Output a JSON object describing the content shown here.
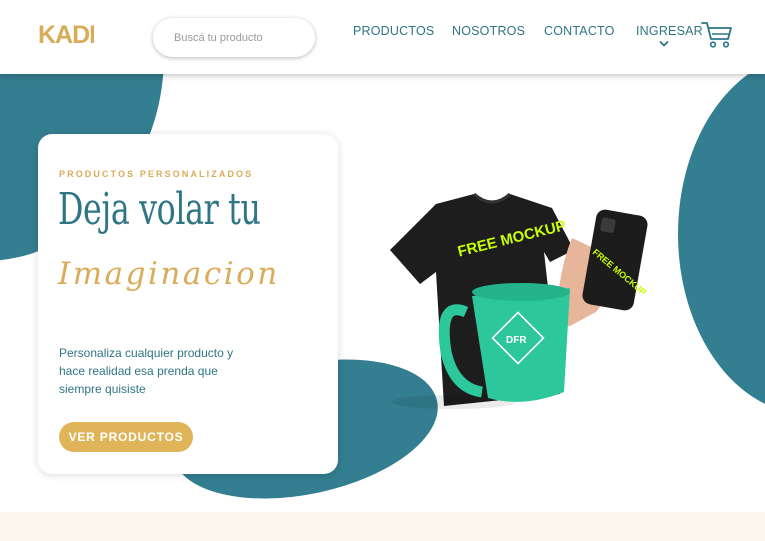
{
  "header": {
    "logo_text": "KADI",
    "search": {
      "placeholder": "Buscá tu producto",
      "value": ""
    },
    "nav": {
      "productos": "PRODUCTOS",
      "nosotros": "NOSOTROS",
      "contacto": "CONTACTO",
      "ingresar": "INGRESAR"
    },
    "icons": [
      "chevron-down-icon",
      "cart-icon"
    ]
  },
  "hero": {
    "eyebrow": "PRODUCTOS PERSONALIZADOS",
    "headline": "Deja volar tu",
    "script": "Imaginacion",
    "description": "Personaliza cualquier producto y hace realidad esa prenda que siempre quisiste",
    "cta_label": "VER PRODUCTOS",
    "mockup_text": {
      "shirt": "FREE MOCKUP",
      "phone": "FREE MOCKUP",
      "mug": "DFR"
    }
  },
  "colors": {
    "brand_teal": "#337e90",
    "accent_gold": "#d9ac5a",
    "cta_gold": "#e0b55a",
    "mockup_green": "#c6ff00",
    "mug_teal": "#2cc79b"
  }
}
